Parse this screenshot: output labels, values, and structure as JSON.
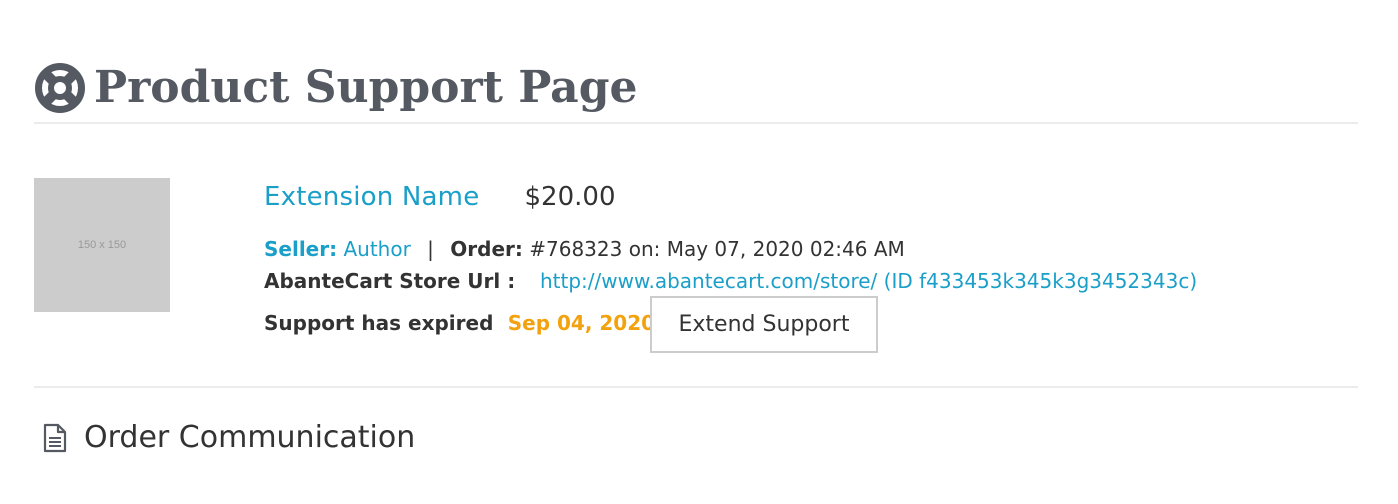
{
  "header": {
    "title": "Product Support Page",
    "icon": "life-ring-icon"
  },
  "product": {
    "thumbnail_text": "150 x 150",
    "name": "Extension Name",
    "price": "$20.00",
    "seller_label": "Seller:",
    "seller_name": "Author",
    "separator": "|",
    "order_label": "Order:",
    "order_value": "#768323 on: May 07, 2020 02:46 AM",
    "store_url_label": "AbanteCart Store Url :",
    "store_url_value": "http://www.abantecart.com/store/ (ID f433453k345k3g3452343c)",
    "support_status": "Support has expired",
    "support_date": "Sep 04, 2020",
    "extend_button": "Extend Support"
  },
  "communication": {
    "title": "Order Communication",
    "icon": "document-icon"
  },
  "colors": {
    "accent": "#1a9fc9",
    "warning": "#f3a20f",
    "heading": "#555961"
  }
}
